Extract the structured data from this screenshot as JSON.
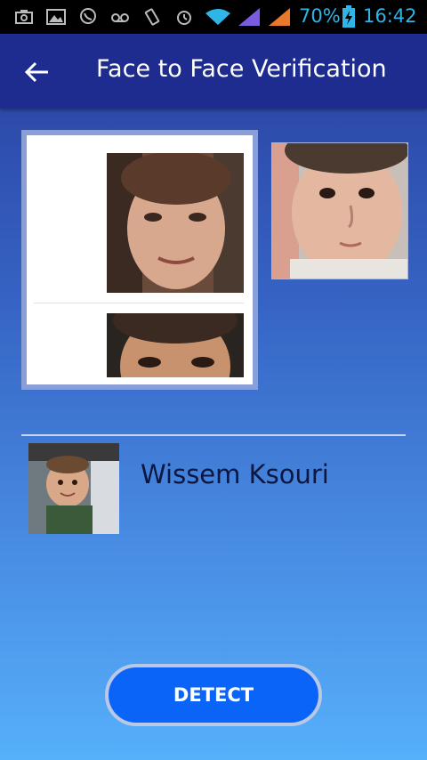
{
  "status_bar": {
    "battery": "70%",
    "time": "16:42",
    "icons": [
      "screenshot-icon",
      "gallery-icon",
      "viber-icon",
      "voicemail-icon",
      "vibrate-icon",
      "alarm-icon",
      "wifi-icon",
      "signal-icon",
      "signal-icon-2",
      "battery-charging-icon"
    ]
  },
  "app_bar": {
    "title": "Face to Face Verification",
    "back_icon": "arrow-left-icon"
  },
  "result": {
    "name": "Wissem Ksouri"
  },
  "detect_button": {
    "label": "DETECT"
  },
  "colors": {
    "app_bar": "#1e2b8f",
    "accent_button": "#0a64f8",
    "status_text": "#30b4e6"
  }
}
